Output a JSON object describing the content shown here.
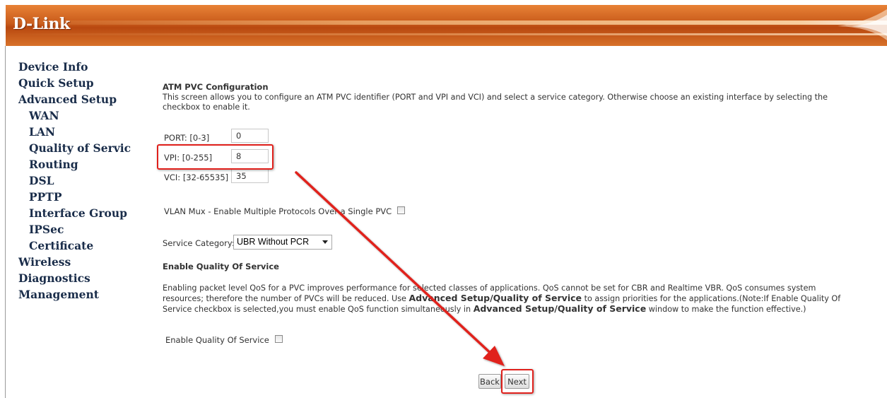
{
  "header": {
    "logo": "D-Link"
  },
  "sidebar": {
    "items": [
      {
        "label": "Device Info"
      },
      {
        "label": "Quick Setup"
      },
      {
        "label": "Advanced Setup"
      },
      {
        "label": "WAN"
      },
      {
        "label": "LAN"
      },
      {
        "label": "Quality of Service"
      },
      {
        "label": "Routing"
      },
      {
        "label": "DSL"
      },
      {
        "label": "PPTP"
      },
      {
        "label": "Interface Group"
      },
      {
        "label": "IPSec"
      },
      {
        "label": "Certificate"
      },
      {
        "label": "Wireless"
      },
      {
        "label": "Diagnostics"
      },
      {
        "label": "Management"
      }
    ]
  },
  "main": {
    "title": "ATM PVC Configuration",
    "description": "This screen allows you to configure an ATM PVC identifier (PORT and VPI and VCI) and select a service category. Otherwise choose an existing interface by selecting the checkbox to enable it.",
    "port": {
      "label": "PORT: [0-3]",
      "value": "0"
    },
    "vpi": {
      "label": "VPI: [0-255]",
      "value": "8"
    },
    "vci": {
      "label": "VCI: [32-65535]",
      "value": "35"
    },
    "vlan_mux": {
      "label": "VLAN Mux - Enable Multiple Protocols Over a Single PVC",
      "checked": false
    },
    "service_category": {
      "label": "Service Category:",
      "selected": "UBR Without PCR"
    },
    "qos": {
      "heading": "Enable Quality Of Service",
      "para_1": "Enabling packet level QoS for a PVC improves performance for selected classes of applications.  QoS cannot be set for CBR and Realtime VBR.  QoS consumes system resources; therefore the number of PVCs will be reduced. Use ",
      "bold_1": "Advanced Setup/Quality of Service",
      "para_2": " to assign priorities for the applications.(Note:If Enable Quality Of Service checkbox is selected,you must enable QoS function simultaneously in ",
      "bold_2": "Advanced Setup/Quality of Service",
      "para_3": " window to make the function effective.)",
      "checkbox_label": "Enable Quality Of Service",
      "checked": false
    },
    "buttons": {
      "back": "Back",
      "next": "Next"
    }
  },
  "colors": {
    "header_orange": "#c85a1a",
    "annotation_red": "#e0201b",
    "nav_text": "#1a2d4a"
  }
}
